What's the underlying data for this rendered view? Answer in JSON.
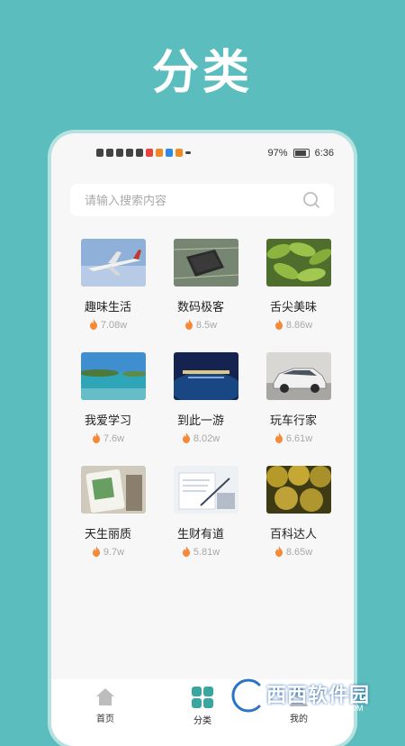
{
  "promo": {
    "title": "分类"
  },
  "status_bar": {
    "battery": "97%",
    "time": "6:36"
  },
  "search": {
    "placeholder": "请输入搜索内容"
  },
  "categories": [
    {
      "name": "趣味生活",
      "heat": "7.08w",
      "image": "airplane"
    },
    {
      "name": "数码极客",
      "heat": "8.5w",
      "image": "circuit-chip"
    },
    {
      "name": "舌尖美味",
      "heat": "8.86w",
      "image": "edamame"
    },
    {
      "name": "我爱学习",
      "heat": "7.6w",
      "image": "seaside"
    },
    {
      "name": "到此一游",
      "heat": "8.02w",
      "image": "presentation-screen"
    },
    {
      "name": "玩车行家",
      "heat": "6.61w",
      "image": "white-suv"
    },
    {
      "name": "天生丽质",
      "heat": "9.7w",
      "image": "product-bottle"
    },
    {
      "name": "生财有道",
      "heat": "5.81w",
      "image": "document-pen"
    },
    {
      "name": "百科达人",
      "heat": "8.65w",
      "image": "durian"
    }
  ],
  "nav": {
    "home": "首页",
    "category": "分类",
    "mine": "我的"
  },
  "watermark": {
    "text": "西西软件园",
    "sub": "CR173.COM"
  },
  "colors": {
    "background": "#5bbdbd",
    "accent": "#5bbdbd",
    "flame": "#f5893a"
  }
}
